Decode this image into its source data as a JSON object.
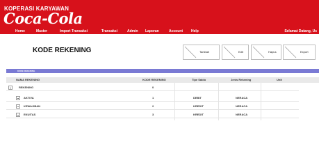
{
  "header": {
    "coop_title": "KOPERASI KARYAWAN",
    "logo_text": "Coca-Cola",
    "nav": [
      "Home",
      "Master",
      "Import Transaksi",
      "Transaksi",
      "Admin",
      "Laporan",
      "Account",
      "Help"
    ],
    "welcome": "Selamat Datang, Us",
    "brand_color": "#d7111b"
  },
  "page_title": "KODE REKENING",
  "toolbar": {
    "tambah": "Tambah",
    "edit": "Edit",
    "hapus": "Hapus",
    "export": "Export"
  },
  "grid": {
    "title": "KODE REKENING",
    "columns": [
      "NAMA REKENING",
      "KODE REKENING",
      "Tipe Saldo",
      "Jenis Rekening",
      "Unit"
    ],
    "rows": [
      {
        "nama": "REKENING",
        "kode": "0",
        "tipe": "",
        "jenis": "",
        "unit": ""
      },
      {
        "nama": "AKTIVA",
        "kode": "1",
        "tipe": "DEBIT",
        "jenis": "NERACA",
        "unit": ""
      },
      {
        "nama": "KEWAJIBAN",
        "kode": "2",
        "tipe": "KREDIT",
        "jenis": "NERACA",
        "unit": ""
      },
      {
        "nama": "EKUITAS",
        "kode": "3",
        "tipe": "KREDIT",
        "jenis": "NERACA",
        "unit": ""
      }
    ],
    "header_color": "#7a7ad4"
  }
}
